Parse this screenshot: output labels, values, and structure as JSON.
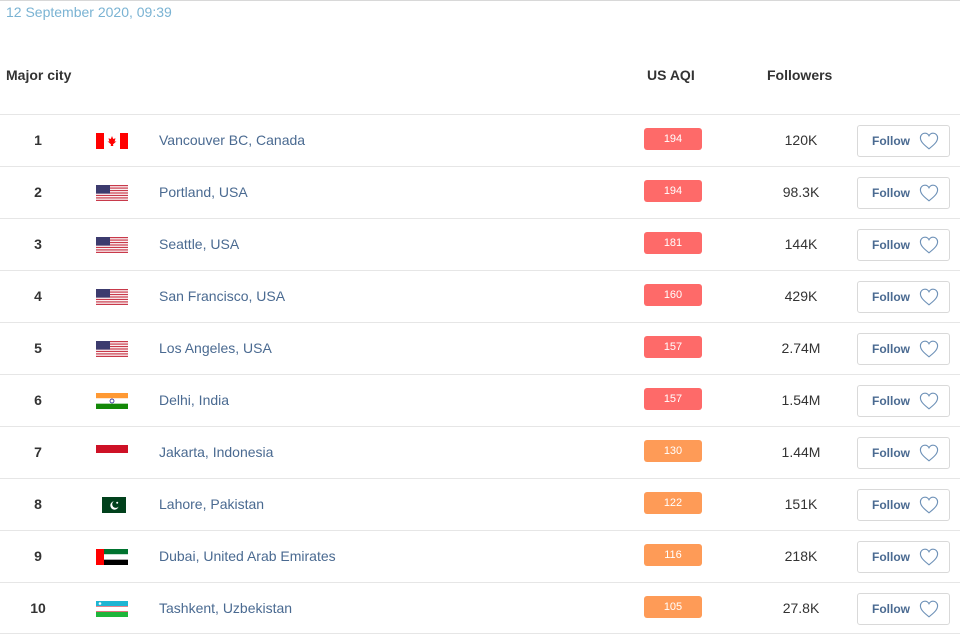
{
  "timestamp": "12 September 2020, 09:39",
  "header": {
    "city": "Major city",
    "aqi": "US AQI",
    "followers": "Followers"
  },
  "colors": {
    "unhealthy": "#fe6a69",
    "sensitive": "#fe9b57",
    "link": "#4a6a91",
    "timestamp": "#7ab3d3"
  },
  "rows": [
    {
      "rank": "1",
      "flag": "canada-flag",
      "city": "Vancouver BC, Canada",
      "aqi": "194",
      "level": "unhealthy",
      "followers": "120K",
      "follow_label": "Follow"
    },
    {
      "rank": "2",
      "flag": "usa-flag",
      "city": "Portland, USA",
      "aqi": "194",
      "level": "unhealthy",
      "followers": "98.3K",
      "follow_label": "Follow"
    },
    {
      "rank": "3",
      "flag": "usa-flag",
      "city": "Seattle, USA",
      "aqi": "181",
      "level": "unhealthy",
      "followers": "144K",
      "follow_label": "Follow"
    },
    {
      "rank": "4",
      "flag": "usa-flag",
      "city": "San Francisco, USA",
      "aqi": "160",
      "level": "unhealthy",
      "followers": "429K",
      "follow_label": "Follow"
    },
    {
      "rank": "5",
      "flag": "usa-flag",
      "city": "Los Angeles, USA",
      "aqi": "157",
      "level": "unhealthy",
      "followers": "2.74M",
      "follow_label": "Follow"
    },
    {
      "rank": "6",
      "flag": "india-flag",
      "city": "Delhi, India",
      "aqi": "157",
      "level": "unhealthy",
      "followers": "1.54M",
      "follow_label": "Follow"
    },
    {
      "rank": "7",
      "flag": "indonesia-flag",
      "city": "Jakarta, Indonesia",
      "aqi": "130",
      "level": "sensitive",
      "followers": "1.44M",
      "follow_label": "Follow"
    },
    {
      "rank": "8",
      "flag": "pakistan-flag",
      "city": "Lahore, Pakistan",
      "aqi": "122",
      "level": "sensitive",
      "followers": "151K",
      "follow_label": "Follow"
    },
    {
      "rank": "9",
      "flag": "uae-flag",
      "city": "Dubai, United Arab Emirates",
      "aqi": "116",
      "level": "sensitive",
      "followers": "218K",
      "follow_label": "Follow"
    },
    {
      "rank": "10",
      "flag": "uzbekistan-flag",
      "city": "Tashkent, Uzbekistan",
      "aqi": "105",
      "level": "sensitive",
      "followers": "27.8K",
      "follow_label": "Follow"
    }
  ]
}
